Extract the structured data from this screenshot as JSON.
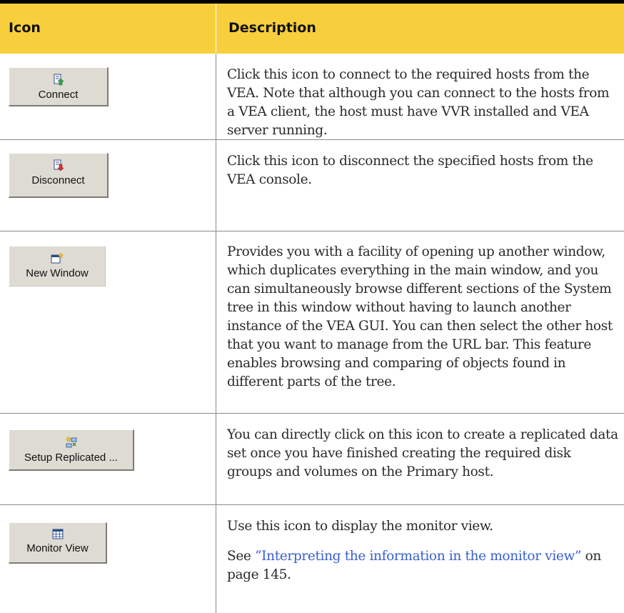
{
  "header": {
    "icon_col": "Icon",
    "description_col": "Description"
  },
  "rows": [
    {
      "button_label": "Connect",
      "icon": "connect-icon",
      "description": "Click this icon to connect to the required hosts from the VEA. Note that although you can connect to the hosts from a VEA client, the host must have VVR installed and VEA server running."
    },
    {
      "button_label": "Disconnect",
      "icon": "disconnect-icon",
      "description": "Click this icon to disconnect the specified hosts from the VEA console."
    },
    {
      "button_label": "New Window",
      "icon": "new-window-icon",
      "description": "Provides you with a facility of opening up another window, which duplicates everything in the main window, and you can simultaneously browse different sections of the System tree in this window without having to launch another instance of the VEA GUI. You can then select the other host that you want to manage from the URL bar. This feature enables browsing and comparing of objects found in different parts of the tree."
    },
    {
      "button_label": "Setup Replicated ...",
      "icon": "setup-replicated-icon",
      "description": "You can directly click on this icon to create a replicated data set once you have finished creating the required disk groups and volumes on the Primary host."
    },
    {
      "button_label": "Monitor View",
      "icon": "monitor-view-icon",
      "description": "Use this icon to display the monitor view.",
      "see_prefix": "See ",
      "see_link": "“Interpreting the information in the monitor view”",
      "see_suffix": " on page 145."
    }
  ],
  "colors": {
    "header_bg": "#f7cf3c",
    "link": "#3a5fcd",
    "button_face": "#dedbd2"
  }
}
